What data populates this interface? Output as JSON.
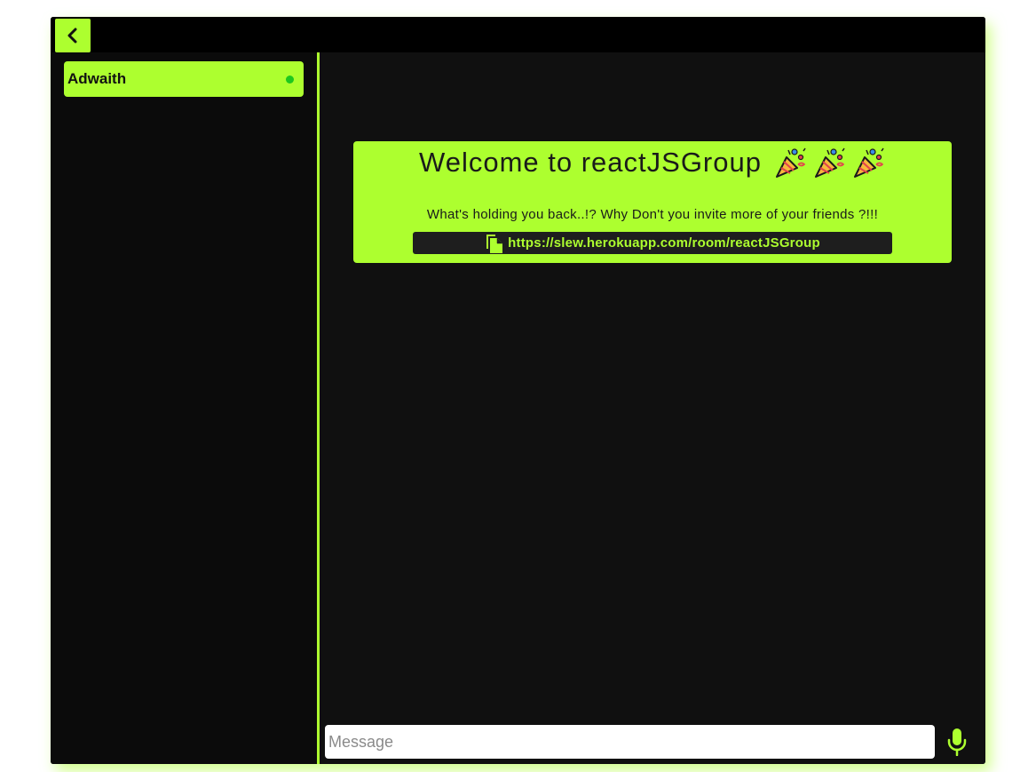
{
  "header": {
    "back_icon": "chevron-left-icon"
  },
  "sidebar": {
    "users": [
      {
        "name": "Adwaith",
        "status": "online",
        "status_color": "#1ec81e"
      }
    ]
  },
  "welcome": {
    "title": "Welcome to reactJSGroup",
    "emoji_icons": [
      "party-popper-icon",
      "party-popper-icon",
      "party-popper-icon"
    ],
    "subtitle": "What's holding you back..!? Why Don't you invite more of your friends ?!!!",
    "link_icon": "copy-icon",
    "link": "https://slew.herokuapp.com/room/reactJSGroup"
  },
  "composer": {
    "placeholder": "Message",
    "value": "",
    "mic_icon": "microphone-icon"
  },
  "colors": {
    "accent": "#adff2f",
    "background": "#0b0b0b",
    "panel": "#101010",
    "link_box": "#1e1e1e"
  }
}
